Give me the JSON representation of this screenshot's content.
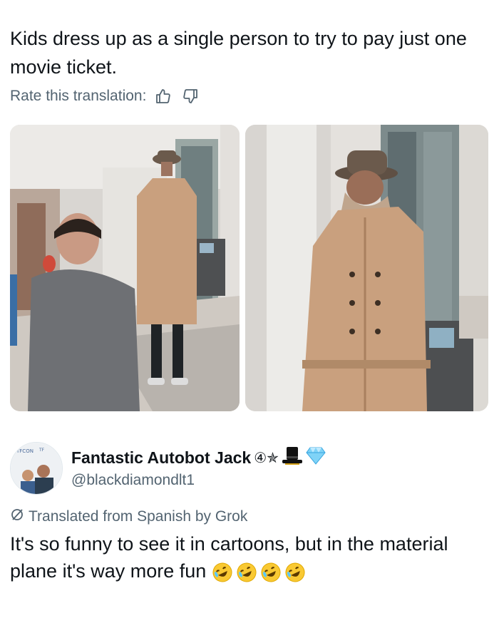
{
  "post": {
    "text": "Kids dress up as a single person to try to pay just one movie ticket.",
    "rate_label": "Rate this translation:",
    "icons": [
      "thumbs-up-icon",
      "thumbs-down-icon"
    ]
  },
  "quote": {
    "display_name": "Fantastic Autobot Jack",
    "badge": "④✯",
    "handle": "@blackdiamondlt1",
    "translated_label": "Translated from Spanish by Grok",
    "text": "It's so funny to see it in cartoons, but in the material plane it's way more fun",
    "emoji": [
      "rofl-emoji",
      "rofl-emoji",
      "rofl-emoji",
      "rofl-emoji"
    ]
  },
  "colors": {
    "text": "#0f1419",
    "secondary": "#536471",
    "coat": "#c9a07e",
    "hat": "#6b5a4c"
  }
}
